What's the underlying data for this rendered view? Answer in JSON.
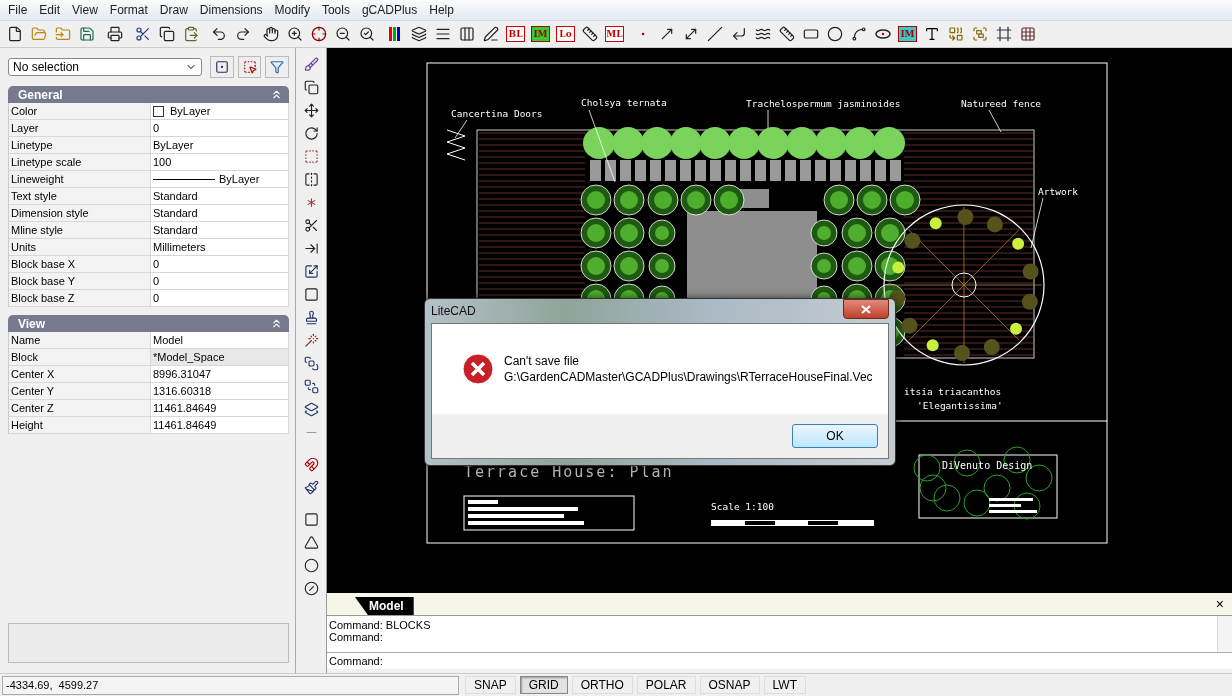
{
  "menu": [
    "File",
    "Edit",
    "View",
    "Format",
    "Draw",
    "Dimensions",
    "Modify",
    "Tools",
    "gCADPlus",
    "Help"
  ],
  "toolbar_badges": [
    "BL",
    "IM",
    "Lo",
    "ML",
    "IM"
  ],
  "selection": {
    "value": "No selection"
  },
  "sections": [
    {
      "title": "General",
      "expanded": true,
      "rows": [
        {
          "label": "Color",
          "value": "ByLayer",
          "kind": "swatch",
          "disabled": false
        },
        {
          "label": "Layer",
          "value": "0",
          "kind": "text",
          "disabled": false
        },
        {
          "label": "Linetype",
          "value": "ByLayer",
          "kind": "text",
          "disabled": false
        },
        {
          "label": "Linetype scale",
          "value": "100",
          "kind": "text",
          "disabled": false
        },
        {
          "label": "Lineweight",
          "value": "ByLayer",
          "kind": "line",
          "disabled": false
        },
        {
          "label": "Text style",
          "value": "Standard",
          "kind": "text",
          "disabled": false
        },
        {
          "label": "Dimension style",
          "value": "Standard",
          "kind": "text",
          "disabled": false
        },
        {
          "label": "Mline style",
          "value": "Standard",
          "kind": "text",
          "disabled": false
        },
        {
          "label": "Units",
          "value": "Millimeters",
          "kind": "text",
          "disabled": false
        },
        {
          "label": "Block base X",
          "value": "0",
          "kind": "text",
          "disabled": false
        },
        {
          "label": "Block base Y",
          "value": "0",
          "kind": "text",
          "disabled": false
        },
        {
          "label": "Block base Z",
          "value": "0",
          "kind": "text",
          "disabled": false
        }
      ]
    },
    {
      "title": "View",
      "expanded": true,
      "rows": [
        {
          "label": "Name",
          "value": "Model",
          "kind": "text",
          "disabled": false
        },
        {
          "label": "Block",
          "value": "*Model_Space",
          "kind": "text",
          "disabled": true
        },
        {
          "label": "Center X",
          "value": "8996.31047",
          "kind": "text",
          "disabled": false
        },
        {
          "label": "Center Y",
          "value": "1316.60318",
          "kind": "text",
          "disabled": false
        },
        {
          "label": "Center Z",
          "value": "11461.84649",
          "kind": "text",
          "disabled": false
        },
        {
          "label": "Height",
          "value": "11461.84649",
          "kind": "text",
          "disabled": false
        }
      ]
    }
  ],
  "drawing": {
    "labels": [
      "Cancertina Doors",
      "Cholsya ternata",
      "Trachelospermum jasminoides",
      "Natureed fence",
      "Artwork",
      "itsia triacanthos",
      "'Elegantissima'"
    ],
    "title": "Terrace House: Plan",
    "scale": "Scale 1:100",
    "studio": "DiVenuto Design"
  },
  "dialog": {
    "title": "LiteCAD",
    "message": "Can't save file",
    "path": "G:\\GardenCADMaster\\GCADPlus\\Drawings\\RTerraceHouseFinal.Vec",
    "button": "OK"
  },
  "layout_tabs": [
    {
      "label": "Model",
      "selected": true
    }
  ],
  "command": {
    "close": "×",
    "history": [
      "Command: BLOCKS",
      "Command:"
    ],
    "prompt": "Command:"
  },
  "status": {
    "coordinates": "-4334.69,  4599.27",
    "toggles": [
      {
        "label": "SNAP",
        "on": false
      },
      {
        "label": "GRID",
        "on": true
      },
      {
        "label": "ORTHO",
        "on": false
      },
      {
        "label": "POLAR",
        "on": false
      },
      {
        "label": "OSNAP",
        "on": false
      },
      {
        "label": "LWT",
        "on": false
      }
    ]
  }
}
